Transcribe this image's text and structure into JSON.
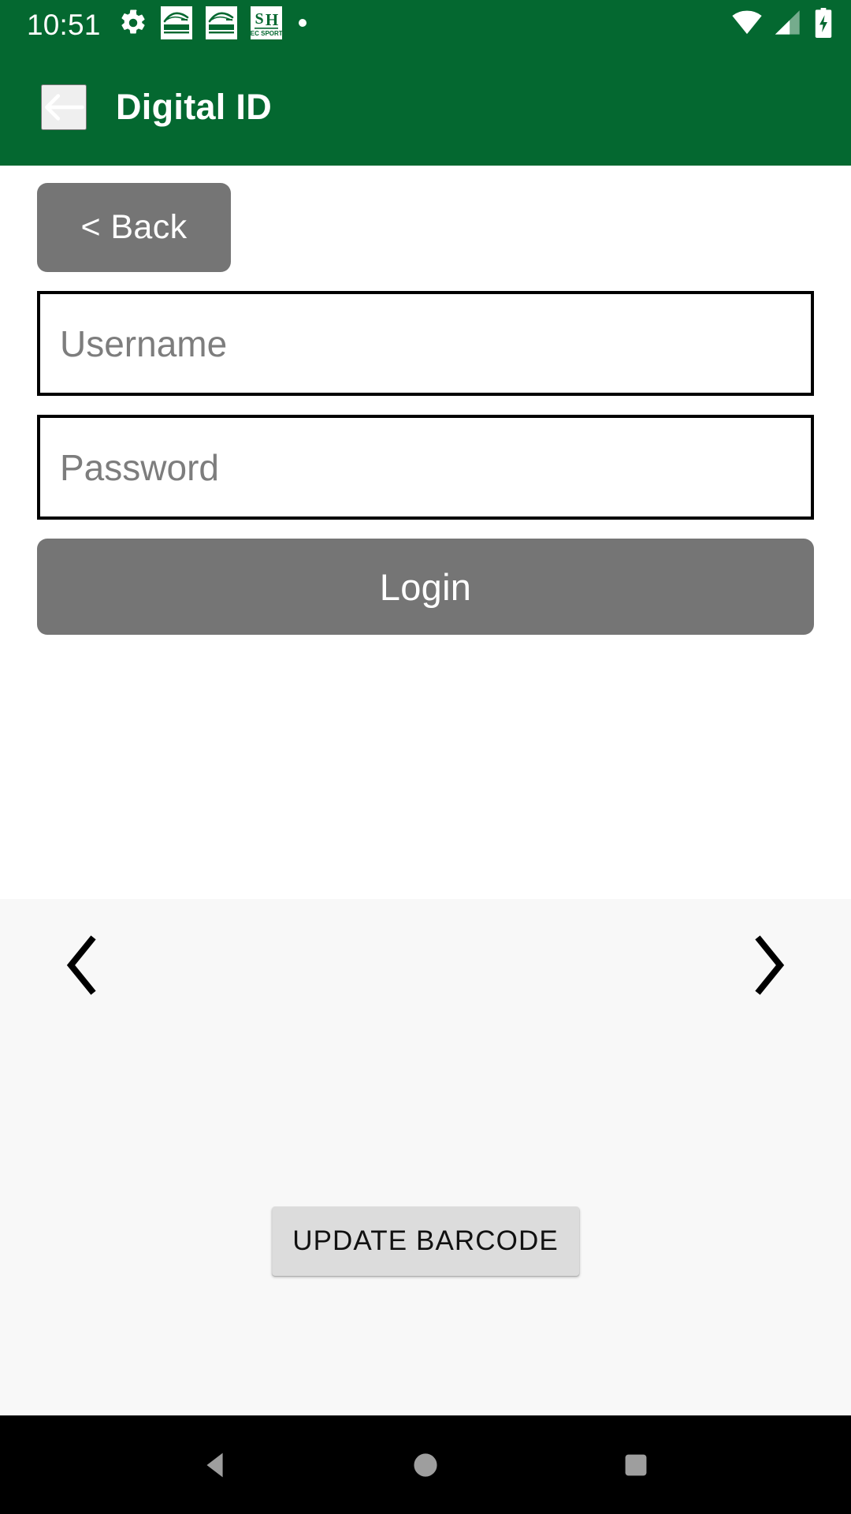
{
  "status_bar": {
    "time": "10:51",
    "notifications": [
      {
        "name": "settings-gear-icon",
        "label": "Settings"
      },
      {
        "name": "campus-recreation-notification-icon",
        "label": "CAMPUS RECREATION"
      },
      {
        "name": "campus-recreation-notification-icon-2",
        "label": "CAMPUS RECREATION"
      },
      {
        "name": "sh-rec-sports-notification-icon",
        "label": "SH REC SPORTS"
      },
      {
        "name": "more-notifications-dot-icon",
        "label": "•"
      }
    ],
    "icons": [
      {
        "name": "wifi-icon",
        "label": "Wi-Fi"
      },
      {
        "name": "cell-signal-icon",
        "label": "Cellular signal"
      },
      {
        "name": "battery-charging-icon",
        "label": "Battery charging"
      }
    ]
  },
  "app_bar": {
    "title": "Digital ID",
    "back_label": "Back"
  },
  "form": {
    "back_button_label": "< Back",
    "username": {
      "placeholder": "Username",
      "value": ""
    },
    "password": {
      "placeholder": "Password",
      "value": ""
    },
    "login_button_label": "Login"
  },
  "barcode_panel": {
    "prev_label": "‹",
    "next_label": "›",
    "update_button_label": "UPDATE BARCODE"
  },
  "system_nav": {
    "back_label": "Back",
    "home_label": "Home",
    "recents_label": "Recent apps"
  },
  "colors": {
    "brand_green": "#046830",
    "button_gray": "#757575",
    "panel_gray": "#f8f8f8",
    "update_button_gray": "#dcdcdc",
    "nav_bar_black": "#000000",
    "placeholder_gray": "#7d7d7d"
  }
}
